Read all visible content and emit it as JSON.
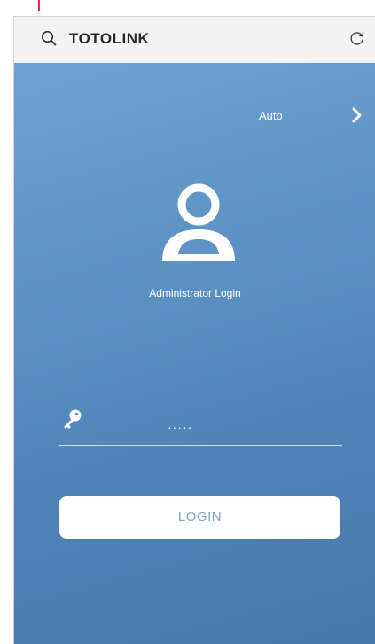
{
  "browser": {
    "address_text": "TOTOLINK",
    "search_icon": "search-icon",
    "refresh_icon": "refresh-icon"
  },
  "header": {
    "language_label": "Auto",
    "language_chevron_icon": "chevron-right-icon"
  },
  "login": {
    "avatar_icon": "user-icon",
    "admin_label": "Administrator Login",
    "key_icon": "key-icon",
    "password_value": "·····",
    "button_label": "LOGIN"
  },
  "colors": {
    "background_top": "#6fa2d3",
    "background_bottom": "#4878ab",
    "button_text": "#7fa3c8"
  }
}
